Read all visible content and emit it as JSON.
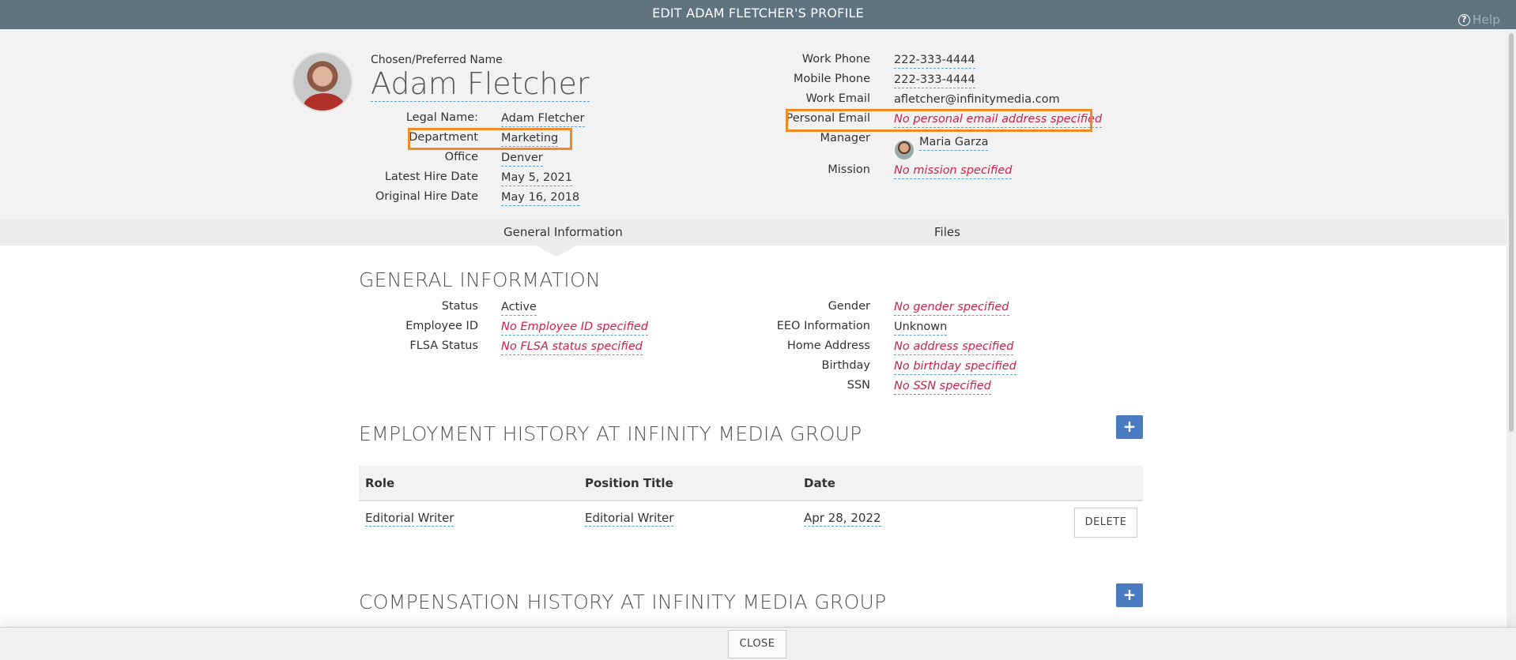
{
  "window": {
    "title": "EDIT ADAM FLETCHER'S PROFILE",
    "help_label": "Help"
  },
  "profile": {
    "preferred_name_label": "Chosen/Preferred Name",
    "name": "Adam Fletcher",
    "left_fields": [
      {
        "label": "Legal Name:",
        "value": "Adam Fletcher"
      },
      {
        "label": "Department",
        "value": "Marketing"
      },
      {
        "label": "Office",
        "value": "Denver"
      },
      {
        "label": "Latest Hire Date",
        "value": "May 5, 2021"
      },
      {
        "label": "Original Hire Date",
        "value": "May 16, 2018"
      }
    ],
    "right_fields": [
      {
        "label": "Work Phone",
        "value": "222-333-4444"
      },
      {
        "label": "Mobile Phone",
        "value": "222-333-4444"
      },
      {
        "label": "Work Email",
        "value": "afletcher@infinitymedia.com"
      },
      {
        "label": "Personal Email",
        "value": "No personal email address specified"
      },
      {
        "label": "Manager",
        "value": "Maria Garza"
      },
      {
        "label": "Mission",
        "value": "No mission specified"
      }
    ]
  },
  "tabs": [
    {
      "label": "General Information",
      "active": true
    },
    {
      "label": "Files",
      "active": false
    }
  ],
  "general": {
    "title": "GENERAL INFORMATION",
    "left_fields": [
      {
        "label": "Status",
        "value": "Active"
      },
      {
        "label": "Employee ID",
        "value": "No Employee ID specified"
      },
      {
        "label": "FLSA Status",
        "value": "No FLSA status specified"
      }
    ],
    "right_fields": [
      {
        "label": "Gender",
        "value": "No gender specified"
      },
      {
        "label": "EEO Information",
        "value": "Unknown"
      },
      {
        "label": "Home Address",
        "value": "No address specified"
      },
      {
        "label": "Birthday",
        "value": "No birthday specified"
      },
      {
        "label": "SSN",
        "value": "No SSN specified"
      }
    ]
  },
  "employment": {
    "title": "EMPLOYMENT HISTORY AT INFINITY MEDIA GROUP",
    "add_label": "+",
    "columns": [
      "Role",
      "Position Title",
      "Date"
    ],
    "rows": [
      {
        "role": "Editorial Writer",
        "position": "Editorial Writer",
        "date": "Apr 28, 2022",
        "delete_label": "DELETE"
      }
    ]
  },
  "compensation": {
    "title": "COMPENSATION HISTORY AT INFINITY MEDIA GROUP",
    "add_label": "+"
  },
  "footer": {
    "close_label": "CLOSE"
  },
  "colors": {
    "titlebar": "#607480",
    "highlight": "#f08a24",
    "empty_value": "#d0204a",
    "add_button": "#4a7ac0",
    "dashed_underline": "#5aa0d8"
  },
  "icons": {
    "help": "help-circle-icon",
    "add": "plus-icon"
  }
}
